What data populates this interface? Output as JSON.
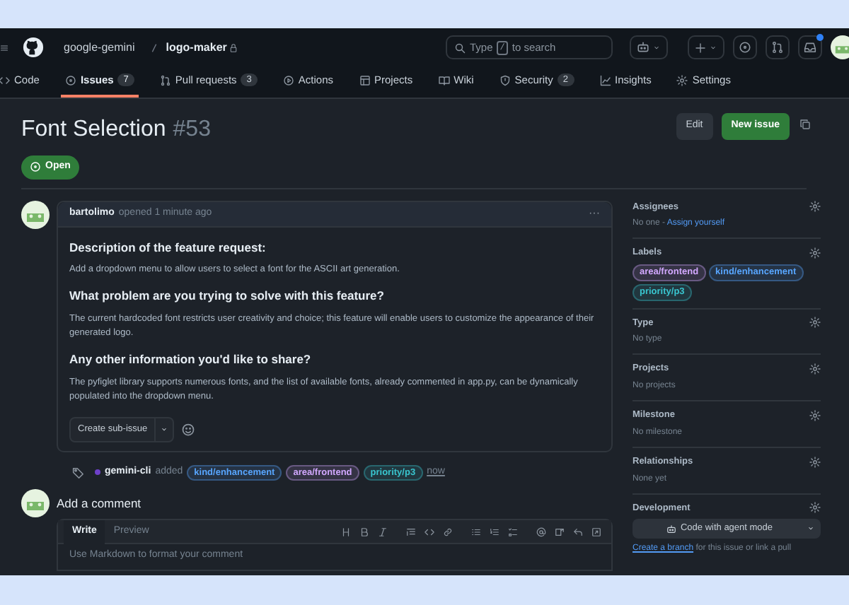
{
  "header": {
    "owner": "google-gemini",
    "repo": "logo-maker",
    "search": {
      "before": "Type",
      "key": "/",
      "after": "to search"
    }
  },
  "tabs": [
    {
      "label": "Code",
      "selected": false
    },
    {
      "label": "Issues",
      "count": "7",
      "selected": true
    },
    {
      "label": "Pull requests",
      "count": "3",
      "selected": false
    },
    {
      "label": "Actions",
      "selected": false
    },
    {
      "label": "Projects",
      "selected": false
    },
    {
      "label": "Wiki",
      "selected": false
    },
    {
      "label": "Security",
      "count": "2",
      "selected": false
    },
    {
      "label": "Insights",
      "selected": false
    },
    {
      "label": "Settings",
      "selected": false
    }
  ],
  "issue": {
    "title": "Font Selection",
    "number": "#53",
    "state": "Open",
    "buttons": [
      "Edit",
      "New issue"
    ]
  },
  "comment": {
    "author": "bartolimo",
    "action": "opened 1 minute ago",
    "menu": "···",
    "body": [
      {
        "kind": "heading",
        "text": "Description of the feature request:"
      },
      {
        "kind": "paragraph",
        "text": "Add a dropdown menu to allow users to select a font for the ASCII art generation."
      },
      {
        "kind": "heading",
        "text": "What problem are you trying to solve with this feature?"
      },
      {
        "kind": "paragraph",
        "text": "The current hardcoded font restricts user creativity and choice; this feature will enable users to customize the appearance of their generated logo."
      },
      {
        "kind": "heading",
        "text": "Any other information you'd like to share?"
      },
      {
        "kind": "paragraph",
        "text": "The pyfiglet library supports numerous fonts, and the list of available fonts, already commented in app.py, can be dynamically populated into the dropdown menu."
      }
    ],
    "sub_issue_button": "Create sub-issue"
  },
  "event": {
    "actor": "gemini-cli",
    "verb": "added",
    "labels": [
      {
        "name": "kind/enhancement",
        "color": "#58a6ff"
      },
      {
        "name": "area/frontend",
        "color": "#d2a8ff"
      },
      {
        "name": "priority/p3",
        "color": "#39c5cf"
      }
    ],
    "time": "now"
  },
  "add_comment": {
    "title": "Add a comment",
    "tabs": [
      {
        "label": "Write",
        "selected": true
      },
      {
        "label": "Preview",
        "selected": false
      }
    ],
    "placeholder": "Use Markdown to format your comment"
  },
  "sidebar": [
    {
      "title": "Assignees",
      "value": "No one - ",
      "link": "Assign yourself"
    },
    {
      "title": "Labels",
      "labels": [
        {
          "name": "area/frontend",
          "color": "#d2a8ff"
        },
        {
          "name": "kind/enhancement",
          "color": "#58a6ff"
        },
        {
          "name": "priority/p3",
          "color": "#39c5cf"
        }
      ]
    },
    {
      "title": "Type",
      "value": "No type"
    },
    {
      "title": "Projects",
      "value": "No projects"
    },
    {
      "title": "Milestone",
      "value": "No milestone"
    },
    {
      "title": "Relationships",
      "value": "None yet"
    },
    {
      "title": "Development",
      "button": "Code with agent mode",
      "link": "Create a branch",
      "value": " for this issue or link a pull"
    }
  ]
}
